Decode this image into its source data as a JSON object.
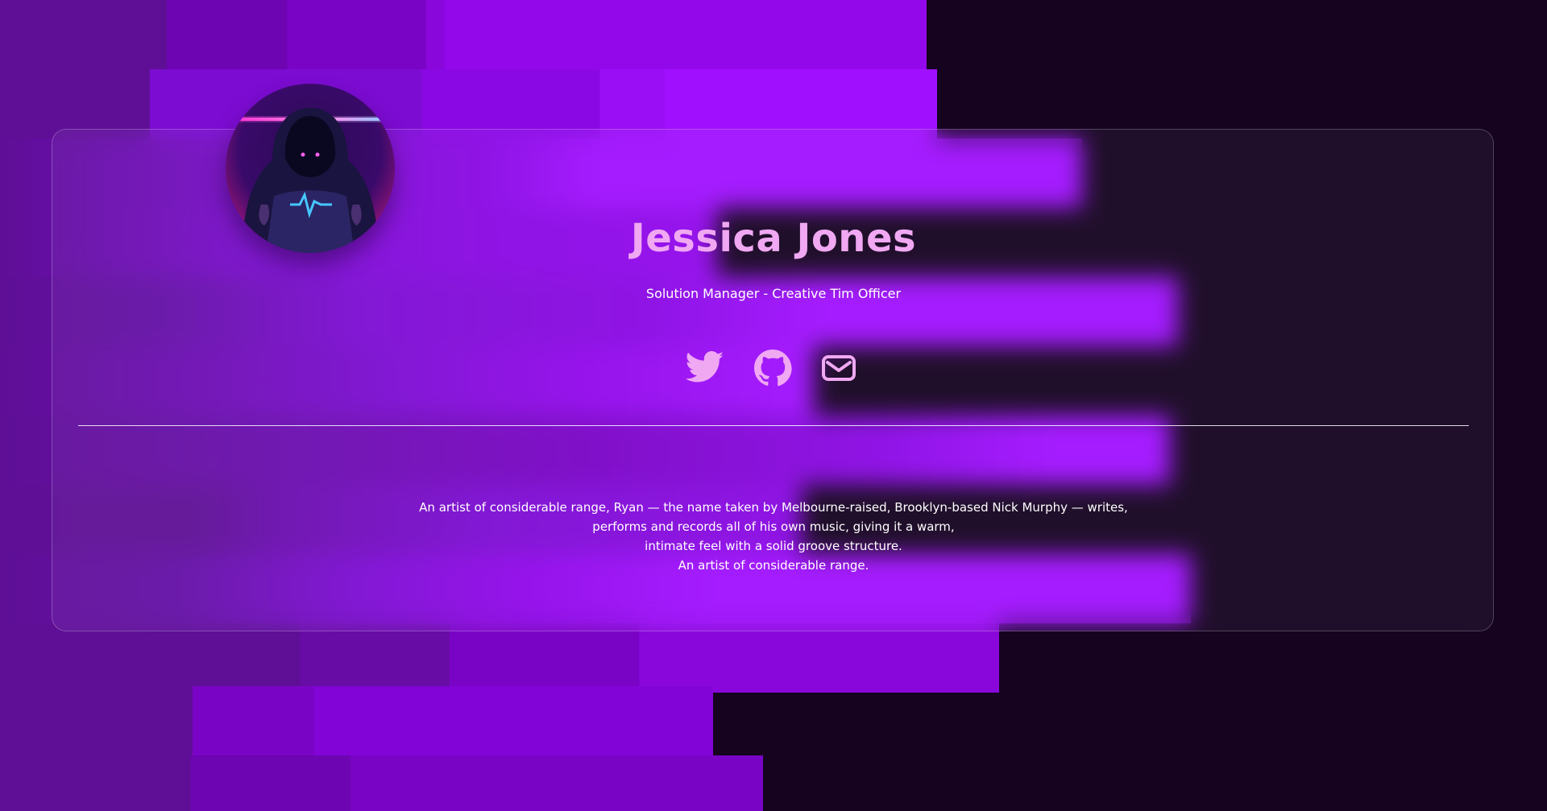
{
  "profile": {
    "name": "Jessica Jones",
    "job_title": "Solution Manager - Creative Tim Officer",
    "avatar_icon": "hooded-figure-avatar",
    "bio_lines": [
      "An artist of considerable range, Ryan — the name taken by Melbourne-raised, Brooklyn-based Nick Murphy — writes,",
      "performs and records all of his own music, giving it a warm,",
      "intimate feel with a solid groove structure.",
      "An artist of considerable range."
    ]
  },
  "socials": [
    {
      "icon": "twitter-icon"
    },
    {
      "icon": "github-icon"
    },
    {
      "icon": "mail-icon"
    }
  ],
  "colors": {
    "accent": "#f0a8f2",
    "background_dark": "#150320",
    "background_purple": "#8b00ff"
  }
}
